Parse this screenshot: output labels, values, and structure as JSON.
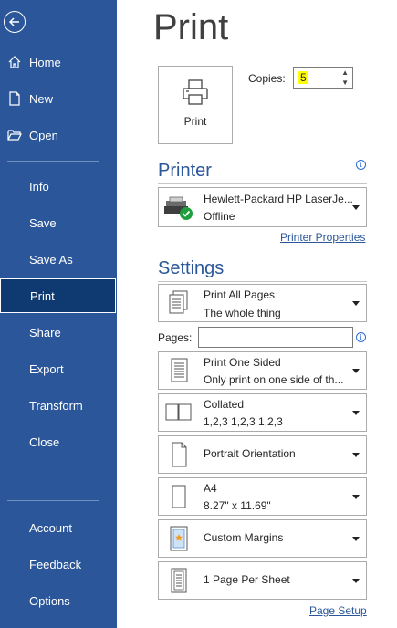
{
  "sidebar": {
    "items": [
      {
        "label": "Home"
      },
      {
        "label": "New"
      },
      {
        "label": "Open"
      },
      {
        "label": "Info"
      },
      {
        "label": "Save"
      },
      {
        "label": "Save As"
      },
      {
        "label": "Print"
      },
      {
        "label": "Share"
      },
      {
        "label": "Export"
      },
      {
        "label": "Transform"
      },
      {
        "label": "Close"
      },
      {
        "label": "Account"
      },
      {
        "label": "Feedback"
      },
      {
        "label": "Options"
      }
    ]
  },
  "main": {
    "title": "Print",
    "print_button_label": "Print",
    "copies_label": "Copies:",
    "copies_value": "5",
    "printer_heading": "Printer",
    "printer": {
      "name": "Hewlett-Packard HP LaserJe...",
      "status": "Offline"
    },
    "printer_properties_link": "Printer Properties",
    "settings_heading": "Settings",
    "pages_label": "Pages:",
    "pages_value": "",
    "settings": [
      {
        "line1": "Print All Pages",
        "line2": "The whole thing"
      },
      {
        "line1": "Print One Sided",
        "line2": "Only print on one side of th..."
      },
      {
        "line1": "Collated",
        "line2": "1,2,3    1,2,3    1,2,3"
      },
      {
        "line1": "Portrait Orientation",
        "line2": ""
      },
      {
        "line1": "A4",
        "line2": "8.27\" x 11.69\""
      },
      {
        "line1": "Custom Margins",
        "line2": ""
      },
      {
        "line1": "1 Page Per Sheet",
        "line2": ""
      }
    ],
    "page_setup_link": "Page Setup"
  },
  "colors": {
    "sidebar_bg": "#2b579a",
    "sidebar_active": "#0e3a71",
    "accent": "#2b579a",
    "highlight": "#ffff00",
    "status_ok": "#1e9e3c"
  }
}
